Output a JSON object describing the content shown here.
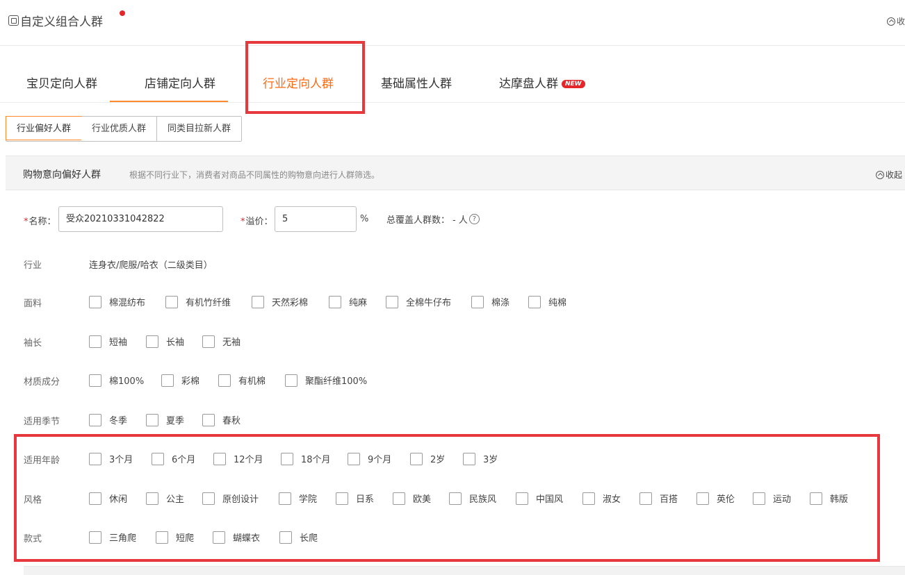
{
  "header": {
    "title": "自定义组合人群",
    "collapse_label": "收"
  },
  "tabs": [
    {
      "label": "宝贝定向人群"
    },
    {
      "label": "店铺定向人群"
    },
    {
      "label": "行业定向人群"
    },
    {
      "label": "基础属性人群"
    },
    {
      "label": "达摩盘人群",
      "badge": "NEW"
    }
  ],
  "subtabs": [
    {
      "label": "行业偏好人群",
      "active": true
    },
    {
      "label": "行业优质人群",
      "active": false
    },
    {
      "label": "同类目拉新人群",
      "active": false
    }
  ],
  "section": {
    "title": "购物意向偏好人群",
    "description": "根据不同行业下，消费者对商品不同属性的购物意向进行人群筛选。",
    "collapse_label": "收起"
  },
  "form": {
    "name_label": "名称：",
    "name_value": "受众20210331042822",
    "premium_label": "溢价：",
    "premium_value": "5",
    "premium_unit": "%",
    "coverage_label": "总覆盖人群数：",
    "coverage_value": "- 人",
    "help_icon": "?"
  },
  "industry": {
    "label": "行业",
    "value": "连身衣/爬服/哈衣（二级类目）"
  },
  "rows": [
    {
      "label": "面料",
      "options": [
        "棉混纺布",
        "有机竹纤维",
        "天然彩棉",
        "纯麻",
        "全棉牛仔布",
        "棉涤",
        "纯棉"
      ]
    },
    {
      "label": "袖长",
      "options": [
        "短袖",
        "长袖",
        "无袖"
      ]
    },
    {
      "label": "材质成分",
      "options": [
        "棉100%",
        "彩棉",
        "有机棉",
        "聚酯纤维100%"
      ]
    },
    {
      "label": "适用季节",
      "options": [
        "冬季",
        "夏季",
        "春秋"
      ]
    },
    {
      "label": "适用年龄",
      "options": [
        "3个月",
        "6个月",
        "12个月",
        "18个月",
        "9个月",
        "2岁",
        "3岁"
      ]
    },
    {
      "label": "风格",
      "options": [
        "休闲",
        "公主",
        "原创设计",
        "学院",
        "日系",
        "欧美",
        "民族风",
        "中国风",
        "淑女",
        "百搭",
        "英伦",
        "运动",
        "韩版"
      ]
    },
    {
      "label": "款式",
      "options": [
        "三角爬",
        "短爬",
        "蝴蝶衣",
        "长爬"
      ]
    }
  ]
}
